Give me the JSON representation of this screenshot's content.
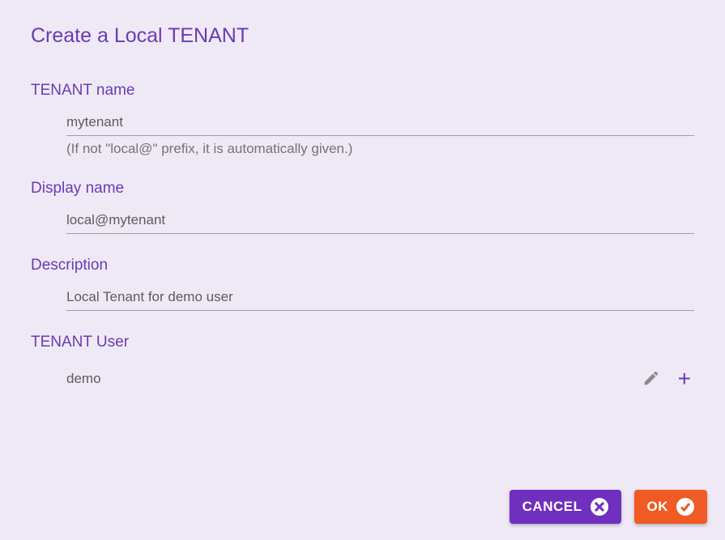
{
  "dialog": {
    "title": "Create a Local TENANT"
  },
  "fields": {
    "tenant_name": {
      "label": "TENANT name",
      "value": "mytenant",
      "helper": "(If not \"local@\" prefix, it is automatically given.)"
    },
    "display_name": {
      "label": "Display name",
      "value": "local@mytenant"
    },
    "description": {
      "label": "Description",
      "value": "Local Tenant for demo user"
    },
    "tenant_user": {
      "label": "TENANT User",
      "value": "demo"
    }
  },
  "buttons": {
    "cancel": "CANCEL",
    "ok": "OK"
  }
}
